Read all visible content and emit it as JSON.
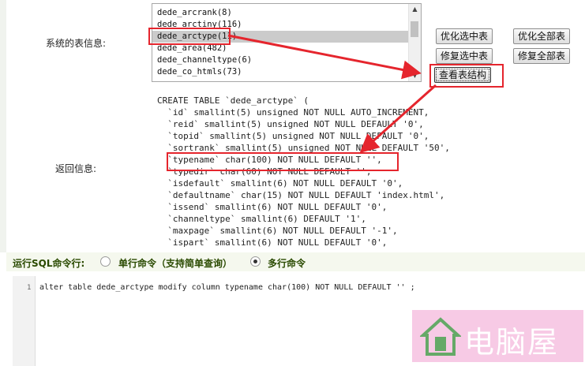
{
  "labels": {
    "table_info": "系统的表信息:",
    "return_info": "返回信息:"
  },
  "table_list": {
    "items": [
      "dede_arcrank(8)",
      "dede_arctiny(116)",
      "dede_arctype(11)",
      "dede_area(482)",
      "dede_channeltype(6)",
      "dede_co_htmls(73)"
    ],
    "selected": "dede_arctype(11)"
  },
  "buttons": {
    "optimize_selected": "优化选中表",
    "optimize_all": "优化全部表",
    "repair_selected": "修复选中表",
    "repair_all": "修复全部表",
    "view_structure": "查看表结构"
  },
  "result_lines": [
    "CREATE TABLE `dede_arctype` (",
    "  `id` smallint(5) unsigned NOT NULL AUTO_INCREMENT,",
    "  `reid` smallint(5) unsigned NOT NULL DEFAULT '0',",
    "  `topid` smallint(5) unsigned NOT NULL DEFAULT '0',",
    "  `sortrank` smallint(5) unsigned NOT NULL DEFAULT '50',",
    "  `typename` char(100) NOT NULL DEFAULT '',",
    "  `typedir` char(60) NOT NULL DEFAULT '',",
    "  `isdefault` smallint(6) NOT NULL DEFAULT '0',",
    "  `defaultname` char(15) NOT NULL DEFAULT 'index.html',",
    "  `issend` smallint(6) NOT NULL DEFAULT '0',",
    "  `channeltype` smallint(6) DEFAULT '1',",
    "  `maxpage` smallint(6) NOT NULL DEFAULT '-1',",
    "  `ispart` smallint(6) NOT NULL DEFAULT '0',"
  ],
  "sql_command": {
    "label": "运行SQL命令行:",
    "option_single": "单行命令（支持简单查询）",
    "option_multi": "多行命令",
    "selected": "multi",
    "line_number": "1",
    "text": "alter table dede_arctype modify column typename char(100) NOT NULL DEFAULT '' ;"
  },
  "watermark": {
    "text": "电脑屋"
  },
  "colors": {
    "annotation_red": "#e5252d",
    "command_bar_bg": "#f5f8ee",
    "watermark_bg": "#f7c6e4"
  }
}
